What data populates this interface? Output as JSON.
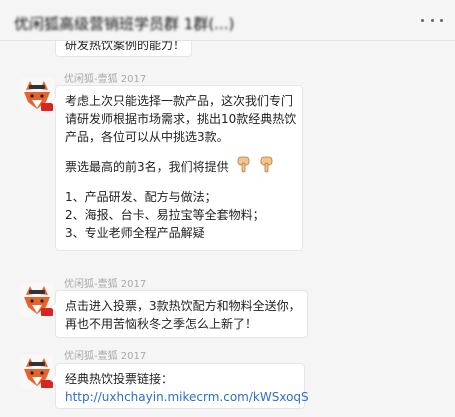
{
  "header": {
    "title": "优闲狐高级营销班学员群 1群(...)",
    "more_icon": "more-dots-icon"
  },
  "messages": [
    {
      "lines": [
        "研发热饮案例的能力！"
      ]
    },
    {
      "sender": "优闲狐-壹狐 2017",
      "avatar_icon": "fox-avatar-icon",
      "para1": [
        "考虑上次只能选择一款产品，这次我们专门",
        "请研发师根据市场需求，挑出10款经典热饮",
        "产品，各位可以从中挑选3款。"
      ],
      "vote_line": "票选最高的前3名，我们将提供",
      "hand_icon": "pointing-down-hand-icon",
      "list": [
        "1、产品研发、配方与做法；",
        "2、海报、台卡、易拉宝等全套物料；",
        "3、专业老师全程产品解疑"
      ]
    },
    {
      "sender": "优闲狐-壹狐 2017",
      "avatar_icon": "fox-avatar-icon",
      "lines": [
        "点击进入投票，3款热饮配方和物料全送你，",
        "再也不用苦恼秋冬之季怎么上新了！"
      ]
    },
    {
      "sender": "优闲狐-壹狐 2017",
      "avatar_icon": "fox-avatar-icon",
      "label": "经典热饮投票链接：",
      "link": "http://uxhchayin.mikecrm.com/kWSxoqS"
    }
  ],
  "colors": {
    "background": "#f5f5f5",
    "bubble": "#ffffff",
    "link": "#2a6fc9",
    "avatar_orange": "#e8632b"
  }
}
